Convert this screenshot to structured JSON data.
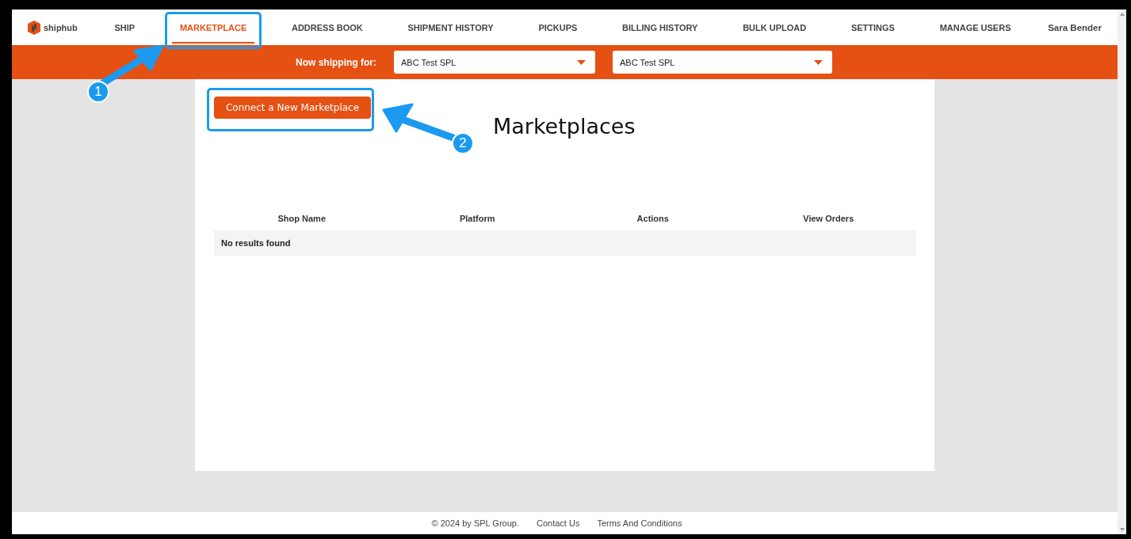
{
  "nav": {
    "logo": "shiphub",
    "items": [
      {
        "label": "SHIP",
        "selected": false
      },
      {
        "label": "MARKETPLACE",
        "selected": true
      },
      {
        "label": "ADDRESS BOOK",
        "selected": false
      },
      {
        "label": "SHIPMENT HISTORY",
        "selected": false
      },
      {
        "label": "PICKUPS",
        "selected": false
      },
      {
        "label": "BILLING HISTORY",
        "selected": false
      },
      {
        "label": "BULK UPLOAD",
        "selected": false
      },
      {
        "label": "SETTINGS",
        "selected": false
      },
      {
        "label": "MANAGE USERS",
        "selected": false
      }
    ],
    "user": "Sara Bender"
  },
  "shipping_bar": {
    "label": "Now shipping for:",
    "selects": [
      {
        "value": "ABC Test SPL"
      },
      {
        "value": "ABC Test SPL"
      }
    ]
  },
  "content": {
    "button": "Connect a New Marketplace",
    "title": "Marketplaces",
    "table": {
      "columns": [
        "Shop Name",
        "Platform",
        "Actions",
        "View Orders"
      ],
      "empty_message": "No results found"
    }
  },
  "footer": {
    "copyright": "© 2024 by SPL Group.",
    "links": [
      "Contact Us",
      "Terms And Conditions"
    ]
  },
  "annotations": [
    {
      "number": "1"
    },
    {
      "number": "2"
    }
  ]
}
